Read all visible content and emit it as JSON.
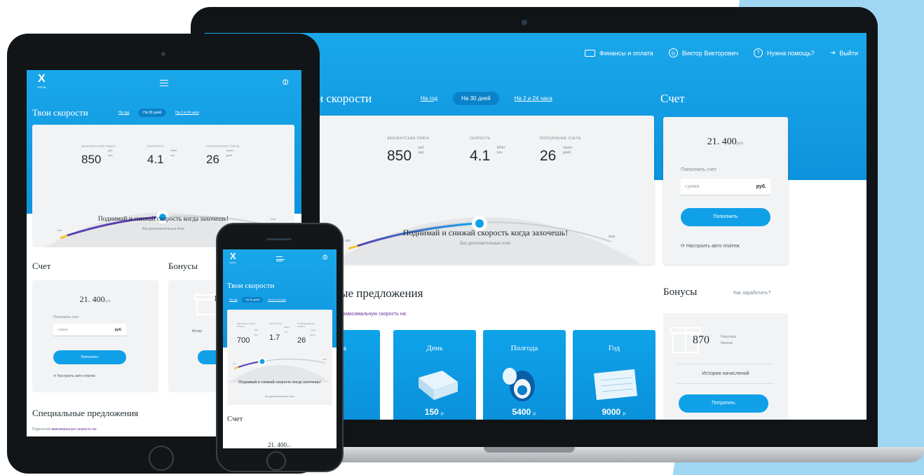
{
  "laptop": {
    "nav": {
      "finance": "Финансы и оплата",
      "user": "Виктор Викторович",
      "help": "Нужна помощь?",
      "logout": "Выйти"
    },
    "speeds": {
      "title": "и скорости",
      "tabs": [
        "На год",
        "На 30 дней",
        "На 2 и 24 часа"
      ],
      "fee_label": "Абонентская плата",
      "fee_value": "850",
      "fee_unit1": "руб.",
      "fee_unit2": "мес",
      "speed_label": "Скорость",
      "speed_value": "4.1",
      "speed_unit1": "Мбит",
      "speed_unit2": "сек.",
      "topup_label": "Пополнение счета",
      "topup_value": "26",
      "topup_unit1": "через",
      "topup_unit2": "дней",
      "min": "min",
      "max": "max",
      "slider_level": 0.55,
      "slogan": "Поднимай и снижай скорость когда захочешь!",
      "sub": "Без дополнительных плат"
    },
    "account": {
      "title": "Счет",
      "sum": "21. 400",
      "sum_unit": "руб.",
      "label": "Пополнить счет",
      "placeholder": "сумма",
      "currency": "руб.",
      "button": "Пополнить",
      "auto": "Настроить авто платеж"
    },
    "special": {
      "title": "альные предложения",
      "sub": "максимальную скорость на:",
      "offers": [
        {
          "title": "Часа",
          "price": "0",
          "unit": "р."
        },
        {
          "title": "День",
          "price": "150",
          "unit": "р."
        },
        {
          "title": "Полгода",
          "price": "5400",
          "unit": "р."
        },
        {
          "title": "Год",
          "price": "9000",
          "unit": "р."
        }
      ]
    },
    "bonus": {
      "title": "Бонусы",
      "link": "Как заработать?",
      "value": "870",
      "unit1": "бонусных",
      "unit2": "баллов",
      "history": "История начислений",
      "button": "Потратить"
    }
  },
  "tablet": {
    "logo": "YOTA",
    "speeds": {
      "title": "Твои скорости",
      "tabs": [
        "На год",
        "На 30 дней",
        "На 2 и 24 часа"
      ],
      "fee_label": "Абонентская плата",
      "fee_value": "850",
      "fee_unit1": "руб.",
      "fee_unit2": "мес",
      "speed_label": "Скорость",
      "speed_value": "4.1",
      "speed_unit1": "Мбит",
      "speed_unit2": "сек.",
      "topup_label": "Пополнение счета",
      "topup_value": "26",
      "topup_unit1": "через",
      "topup_unit2": "дней",
      "min": "min",
      "max": "max",
      "slogan": "Поднимай и снижай скорость когда захочешь!",
      "sub": "Без дополнительных плат"
    },
    "account": {
      "title": "Счет",
      "sum": "21. 400",
      "sum_unit": "руб.",
      "label": "Пополнить счет",
      "placeholder": "сумма",
      "currency": "руб.",
      "button": "Пополнить",
      "auto": "Настроить авто платеж"
    },
    "bonus": {
      "title": "Бонусы",
      "value": "8",
      "history": "Истор"
    },
    "special": {
      "title": "Специальные предложения",
      "sub_prefix": "Подключай",
      "sub_highlight": "максимальную скорость на:"
    }
  },
  "phone": {
    "logo": "YOTA",
    "speeds": {
      "title": "Твои скорости",
      "tabs": [
        "На год",
        "На 30 дней",
        "На 2 и 24 часа"
      ],
      "fee_label": "Абонентская плата",
      "fee_value": "700",
      "fee_unit1": "руб.",
      "fee_unit2": "мес",
      "speed_label": "Скорость",
      "speed_value": "1.7",
      "speed_unit1": "Мбит",
      "speed_unit2": "сек.",
      "topup_label": "Пополнение счета",
      "topup_value": "26",
      "topup_unit1": "через",
      "topup_unit2": "дней",
      "min": "min",
      "max": "max",
      "slogan": "Поднимай и снижай скорость когда захочешь!",
      "sub": "Без дополнительных плат"
    },
    "account": {
      "title": "Счет",
      "sum": "21. 400",
      "sum_unit": "руб."
    }
  },
  "colors": {
    "brand_blue": "#10a0e8",
    "accent_purple": "#6a2e9e",
    "slider_yellow": "#f3c623"
  }
}
